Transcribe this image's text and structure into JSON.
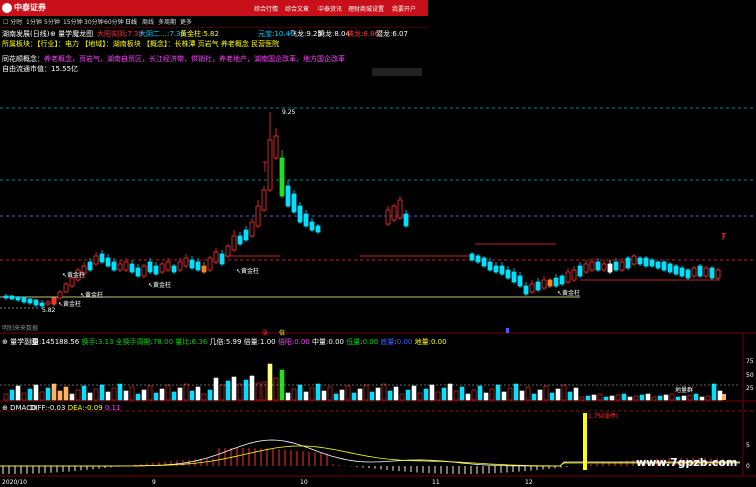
{
  "app": {
    "brand": "中泰证券",
    "nav": [
      "综合行情",
      "综合文章",
      "中泰资讯",
      "理财商城",
      "设置",
      "我要开户"
    ]
  },
  "period_bar": {
    "items": [
      "分时",
      "1分钟",
      "5分钟",
      "15分钟",
      "30分钟",
      "60分钟",
      "日线",
      "周线",
      "多周期",
      "更多"
    ]
  },
  "main_panel": {
    "title": "量学魔龙图",
    "indicators": [
      {
        "label": "大阳实阴",
        "value": "7.38",
        "color": "#ff3030"
      },
      {
        "label": "大阴二…",
        "value": "7.30",
        "color": "#00cfff"
      },
      {
        "label": "黄金柱",
        "value": "5.82",
        "color": "#ffff00"
      },
      {
        "label": "元宝",
        "value": "10.46",
        "color": "#00cfff"
      },
      {
        "label": "飞龙",
        "value": "9.25",
        "color": "#fff"
      },
      {
        "label": "腾龙",
        "value": "8.04",
        "color": "#fff"
      },
      {
        "label": "擒龙",
        "value": "6.86",
        "color": "#ff3030"
      },
      {
        "label": "潜龙",
        "value": "6.07",
        "color": "#fff"
      }
    ],
    "stock_name": "湖南发展(日线)",
    "industry_line": "所属板块：【行业】：电力  【地域】：湖南板块  【概念】：长株潭 页岩气 养老概念 民营医院",
    "concept_line": "养老概念，页岩气，湖南自贸区，长江经济带，供销社，养老地产，湖南国企改革，地方国企改革",
    "concept_label": "同花顺概念：",
    "circ_value": "自由流通市值：15.55亿",
    "price_high_label": "9.25",
    "price_low_label": "5.82",
    "gold_pillar_label": "黄金柱",
    "right_mark": "T",
    "footer_label": "明别来来数据"
  },
  "volume_panel": {
    "title": "量学副图",
    "items": [
      {
        "label": "量",
        "value": "145188.56",
        "color": "#fff"
      },
      {
        "label": "换手",
        "value": "3.13",
        "color": "#00d800"
      },
      {
        "label": "全换手周期",
        "value": "78.00",
        "color": "#00d800"
      },
      {
        "label": "量比",
        "value": "6.36",
        "color": "#00d800"
      },
      {
        "label": "几倍",
        "value": "5.99",
        "color": "#fff"
      },
      {
        "label": "倍量",
        "value": "1.00",
        "color": "#fff"
      },
      {
        "label": "倍阳",
        "value": "0.00",
        "color": "#ff40ff"
      },
      {
        "label": "中量",
        "value": "0.00",
        "color": "#fff"
      },
      {
        "label": "低量",
        "value": "0.00",
        "color": "#00d800"
      },
      {
        "label": "底量",
        "value": "0.00",
        "color": "#4060ff"
      },
      {
        "label": "地量",
        "value": "0.00",
        "color": "#ffff00"
      }
    ],
    "markers": [
      "涨",
      "倍"
    ],
    "right_label": "地量群",
    "axis": [
      "75",
      "50",
      "25"
    ]
  },
  "macd_panel": {
    "title": "DMACD",
    "items": [
      {
        "label": "DIFF",
        "value": "-0.03",
        "color": "#fff"
      },
      {
        "label": "DEA",
        "value": "-0.09",
        "color": "#ffff00"
      },
      {
        "label": "",
        "value": "0.11",
        "color": "#ff40ff"
      }
    ],
    "peak_label": "1.75(涨停)"
  },
  "right_axis": [
    "5",
    "0"
  ],
  "date_axis": [
    "2020/10",
    "9",
    "10",
    "11",
    "12"
  ],
  "watermark": "www.7gpzb.com",
  "colors": {
    "up": "#ff3030",
    "down": "#00e0ff",
    "accent": "#c8101a",
    "gold": "#ffff00"
  }
}
